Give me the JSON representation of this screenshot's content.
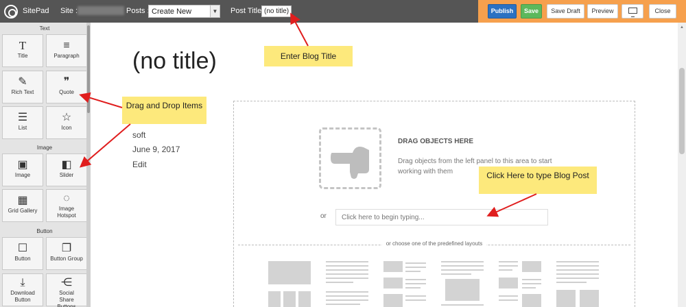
{
  "topbar": {
    "brand": "SitePad",
    "site_label": "Site :",
    "posts_label": "Posts :",
    "posts_selected": "Create New",
    "post_title_label": "Post Title:",
    "post_title_value": "(no title)",
    "buttons": {
      "publish": "Publish",
      "save": "Save",
      "save_draft": "Save Draft",
      "preview": "Preview",
      "close": "Close"
    },
    "colors": {
      "bar": "#555555",
      "accent": "#f6a04d",
      "publish": "#2b71c2",
      "save": "#5cb85c"
    }
  },
  "widgets": {
    "sections": {
      "text": "Text",
      "image": "Image",
      "button": "Button"
    },
    "items": {
      "title": {
        "label": "Title",
        "icon": "T"
      },
      "paragraph": {
        "label": "Paragraph",
        "icon": "≡"
      },
      "rich_text": {
        "label": "Rich Text",
        "icon": "✎"
      },
      "quote": {
        "label": "Quote",
        "icon": "❞"
      },
      "list": {
        "label": "List",
        "icon": "☰"
      },
      "icon": {
        "label": "Icon",
        "icon": "☆"
      },
      "image": {
        "label": "Image",
        "icon": "▣"
      },
      "slider": {
        "label": "Slider",
        "icon": "◧"
      },
      "grid_gallery": {
        "label": "Grid Gallery",
        "icon": "▦"
      },
      "image_hotspot": {
        "label": "Image Hotspot",
        "icon": "◌"
      },
      "button": {
        "label": "Button",
        "icon": "☐"
      },
      "button_group": {
        "label": "Button Group",
        "icon": "❐"
      },
      "download_button": {
        "label": "Download Button",
        "icon": "⤓"
      },
      "social_share": {
        "label": "Social Share Buttons",
        "icon": "⋲"
      }
    }
  },
  "page": {
    "title": "(no title)",
    "author": "soft",
    "date": "June 9, 2017",
    "edit_link": "Edit"
  },
  "dropzone": {
    "heading": "DRAG OBJECTS HERE",
    "description": "Drag objects from the left panel to this area to start working with them",
    "or_label": "or",
    "type_placeholder": "Click here to begin typing...",
    "layouts_label": "or choose one of the predefined layouts",
    "icon": "hand-pointer-icon"
  },
  "callouts": {
    "blog_title": "Enter Blog Title",
    "drag_drop": "Drag and Drop Items",
    "type_post": "Click Here to type Blog Post",
    "arrow_color": "#e01e1e",
    "note_color": "#fde97c"
  }
}
